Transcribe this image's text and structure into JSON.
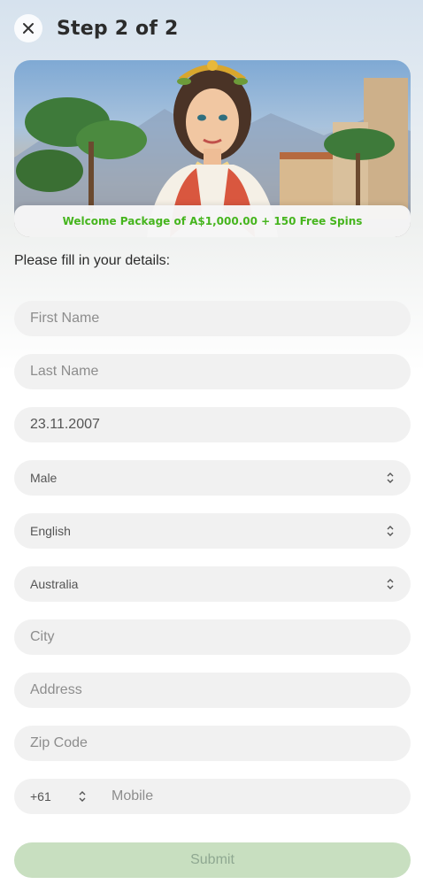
{
  "header": {
    "title": "Step 2 of 2",
    "close_icon": "close-icon"
  },
  "banner": {
    "promo_text": "Welcome Package of A$1,000.00 + 150 Free Spins",
    "promo_color": "#46b51e"
  },
  "form": {
    "instructions": "Please fill in your details:",
    "first_name": {
      "placeholder": "First Name",
      "value": ""
    },
    "last_name": {
      "placeholder": "Last Name",
      "value": ""
    },
    "birth_date": {
      "value": "23.11.2007"
    },
    "gender": {
      "selected": "Male"
    },
    "language": {
      "selected": "English"
    },
    "country": {
      "selected": "Australia"
    },
    "city": {
      "placeholder": "City",
      "value": ""
    },
    "address": {
      "placeholder": "Address",
      "value": ""
    },
    "zip": {
      "placeholder": "Zip Code",
      "value": ""
    },
    "phone": {
      "code": "+61",
      "placeholder": "Mobile",
      "value": ""
    },
    "submit_label": "Submit"
  },
  "colors": {
    "submit_bg": "#c8dfc0",
    "field_bg": "#f1f1f1"
  }
}
